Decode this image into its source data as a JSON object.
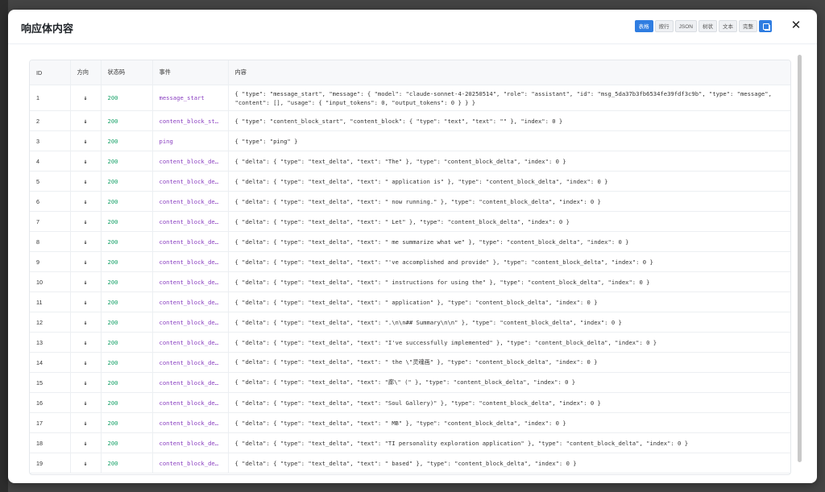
{
  "modal": {
    "title": "响应体内容",
    "toolbar": [
      "表格",
      "按行",
      "JSON",
      "树状",
      "文本",
      "完整"
    ],
    "close": "✕"
  },
  "table": {
    "headers": [
      "ID",
      "方向",
      "状态码",
      "事件",
      "内容"
    ],
    "rows": [
      {
        "id": "1",
        "dir": "↓",
        "status": "200",
        "event": "message_start",
        "content": "{ \"type\": \"message_start\", \"message\": { \"model\": \"claude-sonnet-4-20250514\", \"role\": \"assistant\", \"id\": \"msg_5da37b3fb6534fe39fdf3c9b\", \"type\": \"message\", \"content\": [], \"usage\": { \"input_tokens\": 0, \"output_tokens\": 0 } } }"
      },
      {
        "id": "2",
        "dir": "↓",
        "status": "200",
        "event": "content_block_start",
        "content": "{ \"type\": \"content_block_start\", \"content_block\": { \"type\": \"text\", \"text\": \"\" }, \"index\": 0 }"
      },
      {
        "id": "3",
        "dir": "↓",
        "status": "200",
        "event": "ping",
        "content": "{ \"type\": \"ping\" }"
      },
      {
        "id": "4",
        "dir": "↓",
        "status": "200",
        "event": "content_block_delta",
        "content": "{ \"delta\": { \"type\": \"text_delta\", \"text\": \"The\" }, \"type\": \"content_block_delta\", \"index\": 0 }"
      },
      {
        "id": "5",
        "dir": "↓",
        "status": "200",
        "event": "content_block_delta",
        "content": "{ \"delta\": { \"type\": \"text_delta\", \"text\": \" application is\" }, \"type\": \"content_block_delta\", \"index\": 0 }"
      },
      {
        "id": "6",
        "dir": "↓",
        "status": "200",
        "event": "content_block_delta",
        "content": "{ \"delta\": { \"type\": \"text_delta\", \"text\": \" now running.\" }, \"type\": \"content_block_delta\", \"index\": 0 }"
      },
      {
        "id": "7",
        "dir": "↓",
        "status": "200",
        "event": "content_block_delta",
        "content": "{ \"delta\": { \"type\": \"text_delta\", \"text\": \" Let\" }, \"type\": \"content_block_delta\", \"index\": 0 }"
      },
      {
        "id": "8",
        "dir": "↓",
        "status": "200",
        "event": "content_block_delta",
        "content": "{ \"delta\": { \"type\": \"text_delta\", \"text\": \" me summarize what we\" }, \"type\": \"content_block_delta\", \"index\": 0 }"
      },
      {
        "id": "9",
        "dir": "↓",
        "status": "200",
        "event": "content_block_delta",
        "content": "{ \"delta\": { \"type\": \"text_delta\", \"text\": \"'ve accomplished and provide\" }, \"type\": \"content_block_delta\", \"index\": 0 }"
      },
      {
        "id": "10",
        "dir": "↓",
        "status": "200",
        "event": "content_block_delta",
        "content": "{ \"delta\": { \"type\": \"text_delta\", \"text\": \" instructions for using the\" }, \"type\": \"content_block_delta\", \"index\": 0 }"
      },
      {
        "id": "11",
        "dir": "↓",
        "status": "200",
        "event": "content_block_delta",
        "content": "{ \"delta\": { \"type\": \"text_delta\", \"text\": \" application\" }, \"type\": \"content_block_delta\", \"index\": 0 }"
      },
      {
        "id": "12",
        "dir": "↓",
        "status": "200",
        "event": "content_block_delta",
        "content": "{ \"delta\": { \"type\": \"text_delta\", \"text\": \".\\n\\n## Summary\\n\\n\" }, \"type\": \"content_block_delta\", \"index\": 0 }"
      },
      {
        "id": "13",
        "dir": "↓",
        "status": "200",
        "event": "content_block_delta",
        "content": "{ \"delta\": { \"type\": \"text_delta\", \"text\": \"I've successfully implemented\" }, \"type\": \"content_block_delta\", \"index\": 0 }"
      },
      {
        "id": "14",
        "dir": "↓",
        "status": "200",
        "event": "content_block_delta",
        "content": "{ \"delta\": { \"type\": \"text_delta\", \"text\": \" the \\\"灵魂画\" }, \"type\": \"content_block_delta\", \"index\": 0 }"
      },
      {
        "id": "15",
        "dir": "↓",
        "status": "200",
        "event": "content_block_delta",
        "content": "{ \"delta\": { \"type\": \"text_delta\", \"text\": \"廊\\\" (\" }, \"type\": \"content_block_delta\", \"index\": 0 }"
      },
      {
        "id": "16",
        "dir": "↓",
        "status": "200",
        "event": "content_block_delta",
        "content": "{ \"delta\": { \"type\": \"text_delta\", \"text\": \"Soul Gallery)\" }, \"type\": \"content_block_delta\", \"index\": 0 }"
      },
      {
        "id": "17",
        "dir": "↓",
        "status": "200",
        "event": "content_block_delta",
        "content": "{ \"delta\": { \"type\": \"text_delta\", \"text\": \" MB\" }, \"type\": \"content_block_delta\", \"index\": 0 }"
      },
      {
        "id": "18",
        "dir": "↓",
        "status": "200",
        "event": "content_block_delta",
        "content": "{ \"delta\": { \"type\": \"text_delta\", \"text\": \"TI personality exploration application\" }, \"type\": \"content_block_delta\", \"index\": 0 }"
      },
      {
        "id": "19",
        "dir": "↓",
        "status": "200",
        "event": "content_block_delta",
        "content": "{ \"delta\": { \"type\": \"text_delta\", \"text\": \" based\" }, \"type\": \"content_block_delta\", \"index\": 0 }"
      }
    ]
  }
}
